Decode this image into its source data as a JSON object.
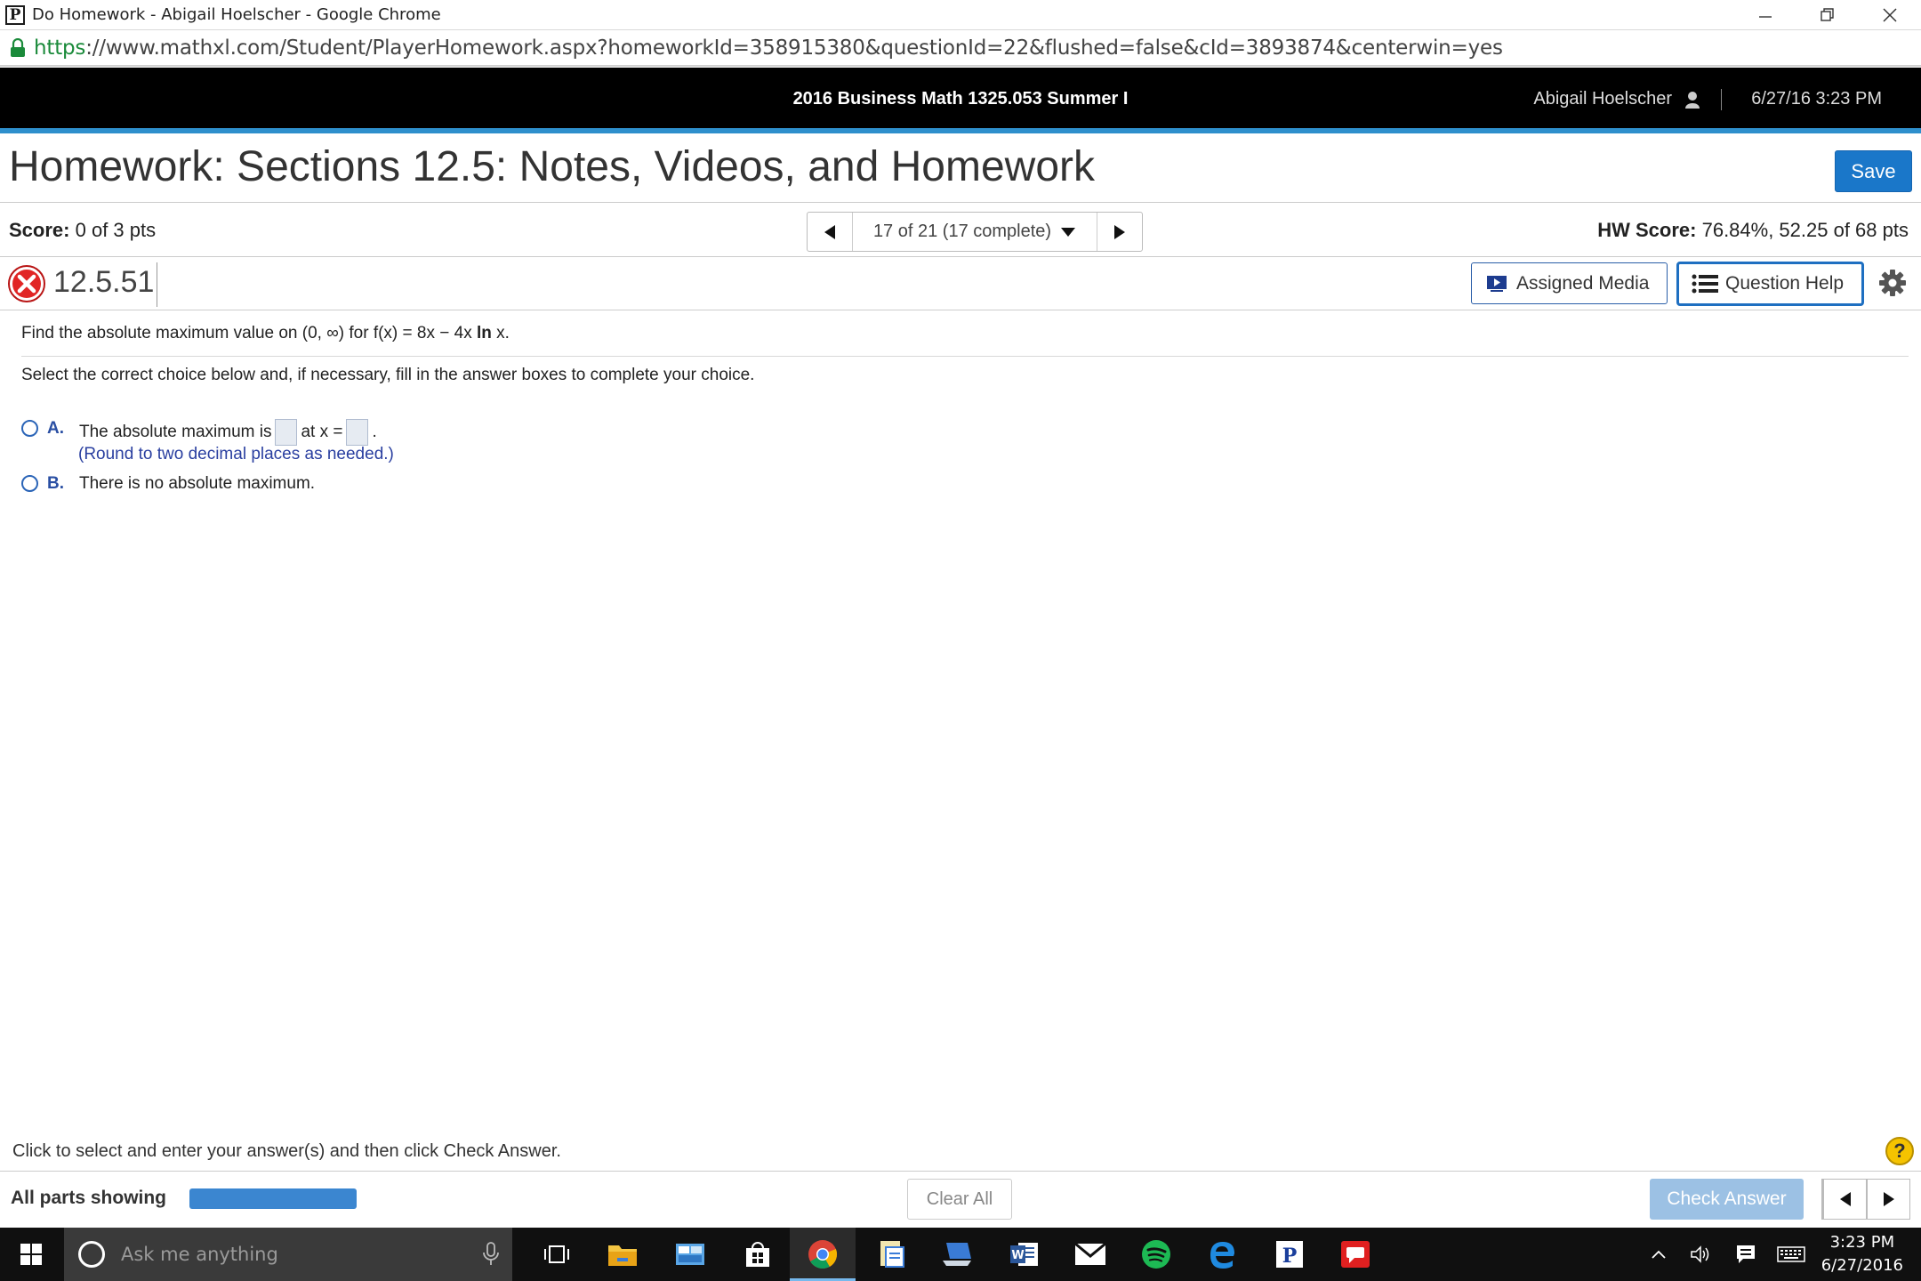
{
  "browser": {
    "window_title": "Do Homework - Abigail Hoelscher - Google Chrome",
    "url_scheme": "https",
    "url_rest": "://www.mathxl.com/Student/PlayerHomework.aspx?homeworkId=358915380&questionId=22&flushed=false&cId=3893874&centerwin=yes"
  },
  "course_header": {
    "course": "2016 Business Math 1325.053 Summer I",
    "user": "Abigail Hoelscher",
    "datetime": "6/27/16 3:23 PM"
  },
  "homework": {
    "title": "Homework: Sections 12.5: Notes, Videos, and Homework",
    "save_label": "Save",
    "score_label": "Score:",
    "score_value": "0 of 3 pts",
    "question_position": "17 of 21 (17 complete)",
    "hw_score_label": "HW Score:",
    "hw_score_value": "76.84%, 52.25 of 68 pts"
  },
  "question": {
    "id": "12.5.51",
    "assigned_media_label": "Assigned Media",
    "question_help_label": "Question Help",
    "prompt_before": "Find the absolute maximum value on (0, ∞) for f(x) = 8x − 4x ",
    "prompt_ln": "ln",
    "prompt_after": " x.",
    "instructions": "Select the correct choice below and, if necessary, fill in the answer boxes to complete your choice.",
    "choices": [
      {
        "letter": "A.",
        "text_before": "The absolute maximum is",
        "text_middle": "at x =",
        "text_end": ".",
        "hint": "(Round to two decimal places as needed.)"
      },
      {
        "letter": "B.",
        "text": "There is no absolute maximum."
      }
    ]
  },
  "footer": {
    "hint": "Click to select and enter your answer(s) and then click Check Answer.",
    "help_symbol": "?",
    "parts_label": "All parts showing",
    "progress_fraction": 1.0,
    "clear_label": "Clear All",
    "check_label": "Check Answer"
  },
  "taskbar": {
    "search_placeholder": "Ask me anything",
    "time": "3:23 PM",
    "date": "6/27/2016"
  },
  "colors": {
    "accent_blue": "#1a77c9",
    "header_bg": "#000000",
    "header_stripe": "#2e8fcc",
    "error_red": "#d81e1e",
    "hint_blue": "#2a3fa0"
  }
}
